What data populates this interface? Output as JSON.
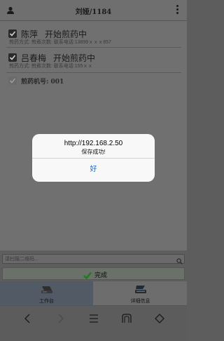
{
  "header": {
    "title": "刘娅/1184",
    "user_icon": "person-icon",
    "menu_icon": "more-vertical-icon"
  },
  "list": {
    "items": [
      {
        "name": "陈萍",
        "status": "开始煎药中",
        "detail": "煎药方式: 煎煮次数: 联系电话:13899ｘｘｘ857",
        "checked": true
      },
      {
        "name": "吕春梅",
        "status": "开始煎药中",
        "detail": "煎药方式: 煎煮次数: 联系电话:155ｘｘ",
        "checked": true
      }
    ],
    "machine_label": "煎药机号: 001"
  },
  "dialog": {
    "title": "http://192.168.2.50",
    "message": "保存成功!",
    "ok_label": "好"
  },
  "search": {
    "placeholder": "请扫描二维码..."
  },
  "complete_button": {
    "label": "完成"
  },
  "tabs": [
    {
      "label": "工作台",
      "icon": "workbench-icon",
      "active": true
    },
    {
      "label": "详细信息",
      "icon": "scanner-icon",
      "active": false
    }
  ],
  "colors": {
    "accent": "#0a72e6",
    "active_tab": "#525a66",
    "check_green": "#1e7a1e"
  }
}
